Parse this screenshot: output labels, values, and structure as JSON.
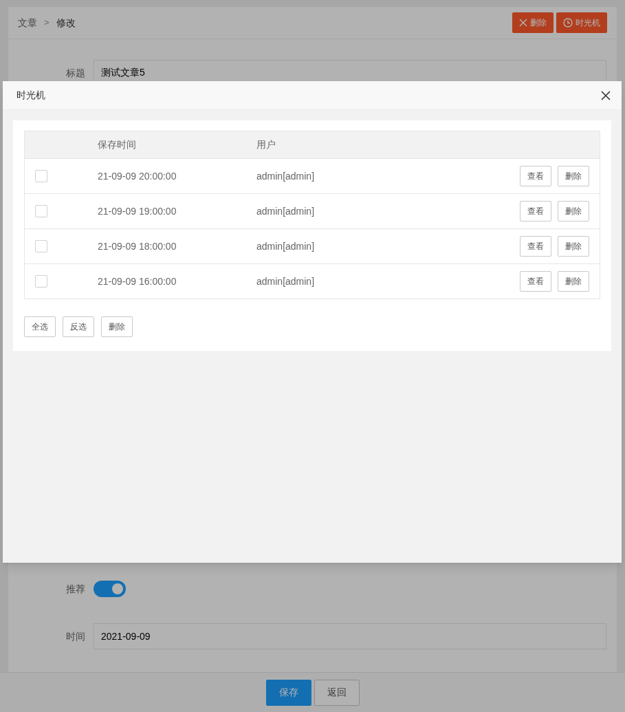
{
  "breadcrumb": {
    "items": [
      "文章",
      "修改"
    ],
    "separator": ">"
  },
  "header_buttons": [
    {
      "label": "删除",
      "kind": "delete"
    },
    {
      "label": "时光机",
      "kind": "history"
    }
  ],
  "fields": [
    {
      "kind": "text",
      "label": "标题",
      "value": "测试文章5"
    },
    {
      "kind": "toggle",
      "label": "推荐",
      "on": true
    },
    {
      "kind": "text",
      "label": "时间",
      "value": "2021-09-09"
    }
  ],
  "footer_buttons": [
    {
      "label": "保存",
      "kind": "primary"
    },
    {
      "label": "返回",
      "kind": "default"
    }
  ],
  "modal": {
    "title": "时光机",
    "columns": [
      "保存时间",
      "用户"
    ],
    "rows": [
      {
        "checked": false,
        "time": "21-09-09 20:00:00",
        "user": "admin[admin]",
        "actions": [
          "查看",
          "删除"
        ]
      },
      {
        "checked": false,
        "time": "21-09-09 19:00:00",
        "user": "admin[admin]",
        "actions": [
          "查看",
          "删除"
        ]
      },
      {
        "checked": false,
        "time": "21-09-09 18:00:00",
        "user": "admin[admin]",
        "actions": [
          "查看",
          "删除"
        ]
      },
      {
        "checked": false,
        "time": "21-09-09 16:00:00",
        "user": "admin[admin]",
        "actions": [
          "查看",
          "删除"
        ]
      }
    ],
    "bulk_buttons": [
      "全选",
      "反选",
      "删除"
    ]
  }
}
